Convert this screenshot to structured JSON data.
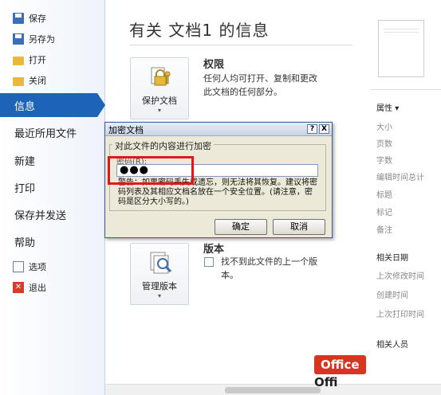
{
  "nav": {
    "save": "保存",
    "save_as": "另存为",
    "open": "打开",
    "close": "关闭",
    "info": "信息",
    "recent": "最近所用文件",
    "new": "新建",
    "print": "打印",
    "save_send": "保存并发送",
    "help": "帮助",
    "options": "选项",
    "exit": "退出"
  },
  "main": {
    "title": "有关 文档1 的信息",
    "permissions": {
      "title": "权限",
      "desc_line1": "任何人均可打开、复制和更改",
      "desc_line2": "此文档的任何部分。",
      "button": "保护文档",
      "caret": "▾"
    },
    "versions": {
      "title": "版本",
      "desc_line1": "找不到此文件的上一个版",
      "desc_line2": "本。",
      "button": "管理版本",
      "caret": "▾"
    }
  },
  "properties": {
    "header": "属性",
    "header_caret": "▾",
    "items": [
      "大小",
      "页数",
      "字数",
      "编辑时间总计",
      "标题",
      "标记",
      "备注"
    ],
    "dates_header": "相关日期",
    "dates": [
      "上次修改时间",
      "创建时间",
      "上次打印时间"
    ],
    "people_header": "相关人员"
  },
  "dialog": {
    "title": "加密文档",
    "help_btn": "?",
    "close_btn": "X",
    "group_label": "对此文件的内容进行加密",
    "password_label": "密码(R):",
    "password_value": "●●●",
    "warning": "警告：如果密码丢失或遗忘，则无法将其恢复。建议将密码列表及其相应文档名放在一个安全位置。(请注意，密码是区分大小写的。)",
    "ok": "确定",
    "cancel": "取消"
  },
  "watermark": {
    "top": "Office",
    "bottom": "Offi"
  }
}
